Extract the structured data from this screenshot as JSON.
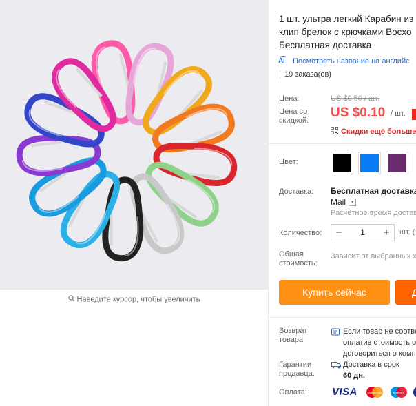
{
  "product": {
    "title_line1": "1 шт. ультра легкий Карабин из",
    "title_line2": "клип брелок с крючками Восхо",
    "title_line3": "Бесплатная доставка"
  },
  "translate": {
    "ai_label": "ĀI",
    "link": "Посмотреть название на английс"
  },
  "orders": "19 заказа(ов)",
  "price": {
    "label": "Цена:",
    "old": "US $0.50 / шт.",
    "discount_label_1": "Цена со",
    "discount_label_2": "скидкой:",
    "current": "US $0.10",
    "per": "/ шт.",
    "coupon": "Скидки ещё больше"
  },
  "color": {
    "label": "Цвет:",
    "swatches": [
      "#000000",
      "#0a7cf5",
      "#6a2a6e"
    ]
  },
  "shipping": {
    "label": "Доставка:",
    "main": "Бесплатная доставка в",
    "carrier": "Mail",
    "estimate": "Расчётное время достав"
  },
  "quantity": {
    "label": "Количество:",
    "minus": "−",
    "value": "1",
    "plus": "+",
    "unit": "шт. (1"
  },
  "total": {
    "label_1": "Общая",
    "label_2": "стоимость:",
    "value": "Зависит от выбранных х"
  },
  "buttons": {
    "buy": "Купить сейчас",
    "cart": "Д"
  },
  "returns": {
    "label_1": "Возврат",
    "label_2": "товара",
    "line1": "Если товар не соотве",
    "line2": "оплатив стоимость о",
    "line3": "договориться о комп"
  },
  "guarantee": {
    "label_1": "Гарантии",
    "label_2": "продавца:",
    "line1": "Доставка в срок",
    "line2": "60 дн."
  },
  "payment": {
    "label": "Оплата:",
    "visa": "VISA",
    "mastercard": "MasterCard",
    "maestro": "Maestro"
  },
  "zoom_hint": "Наведите курсор, чтобы увеличить",
  "carabiner_colors": [
    "#ff5aa8",
    "#e6a6d8",
    "#f0a91c",
    "#f07a20",
    "#d8262c",
    "#8fd18a",
    "#c9c9c9",
    "#222222",
    "#2bb0e8",
    "#1a9be0",
    "#8a3ad0",
    "#3346c8",
    "#e02ba0"
  ]
}
